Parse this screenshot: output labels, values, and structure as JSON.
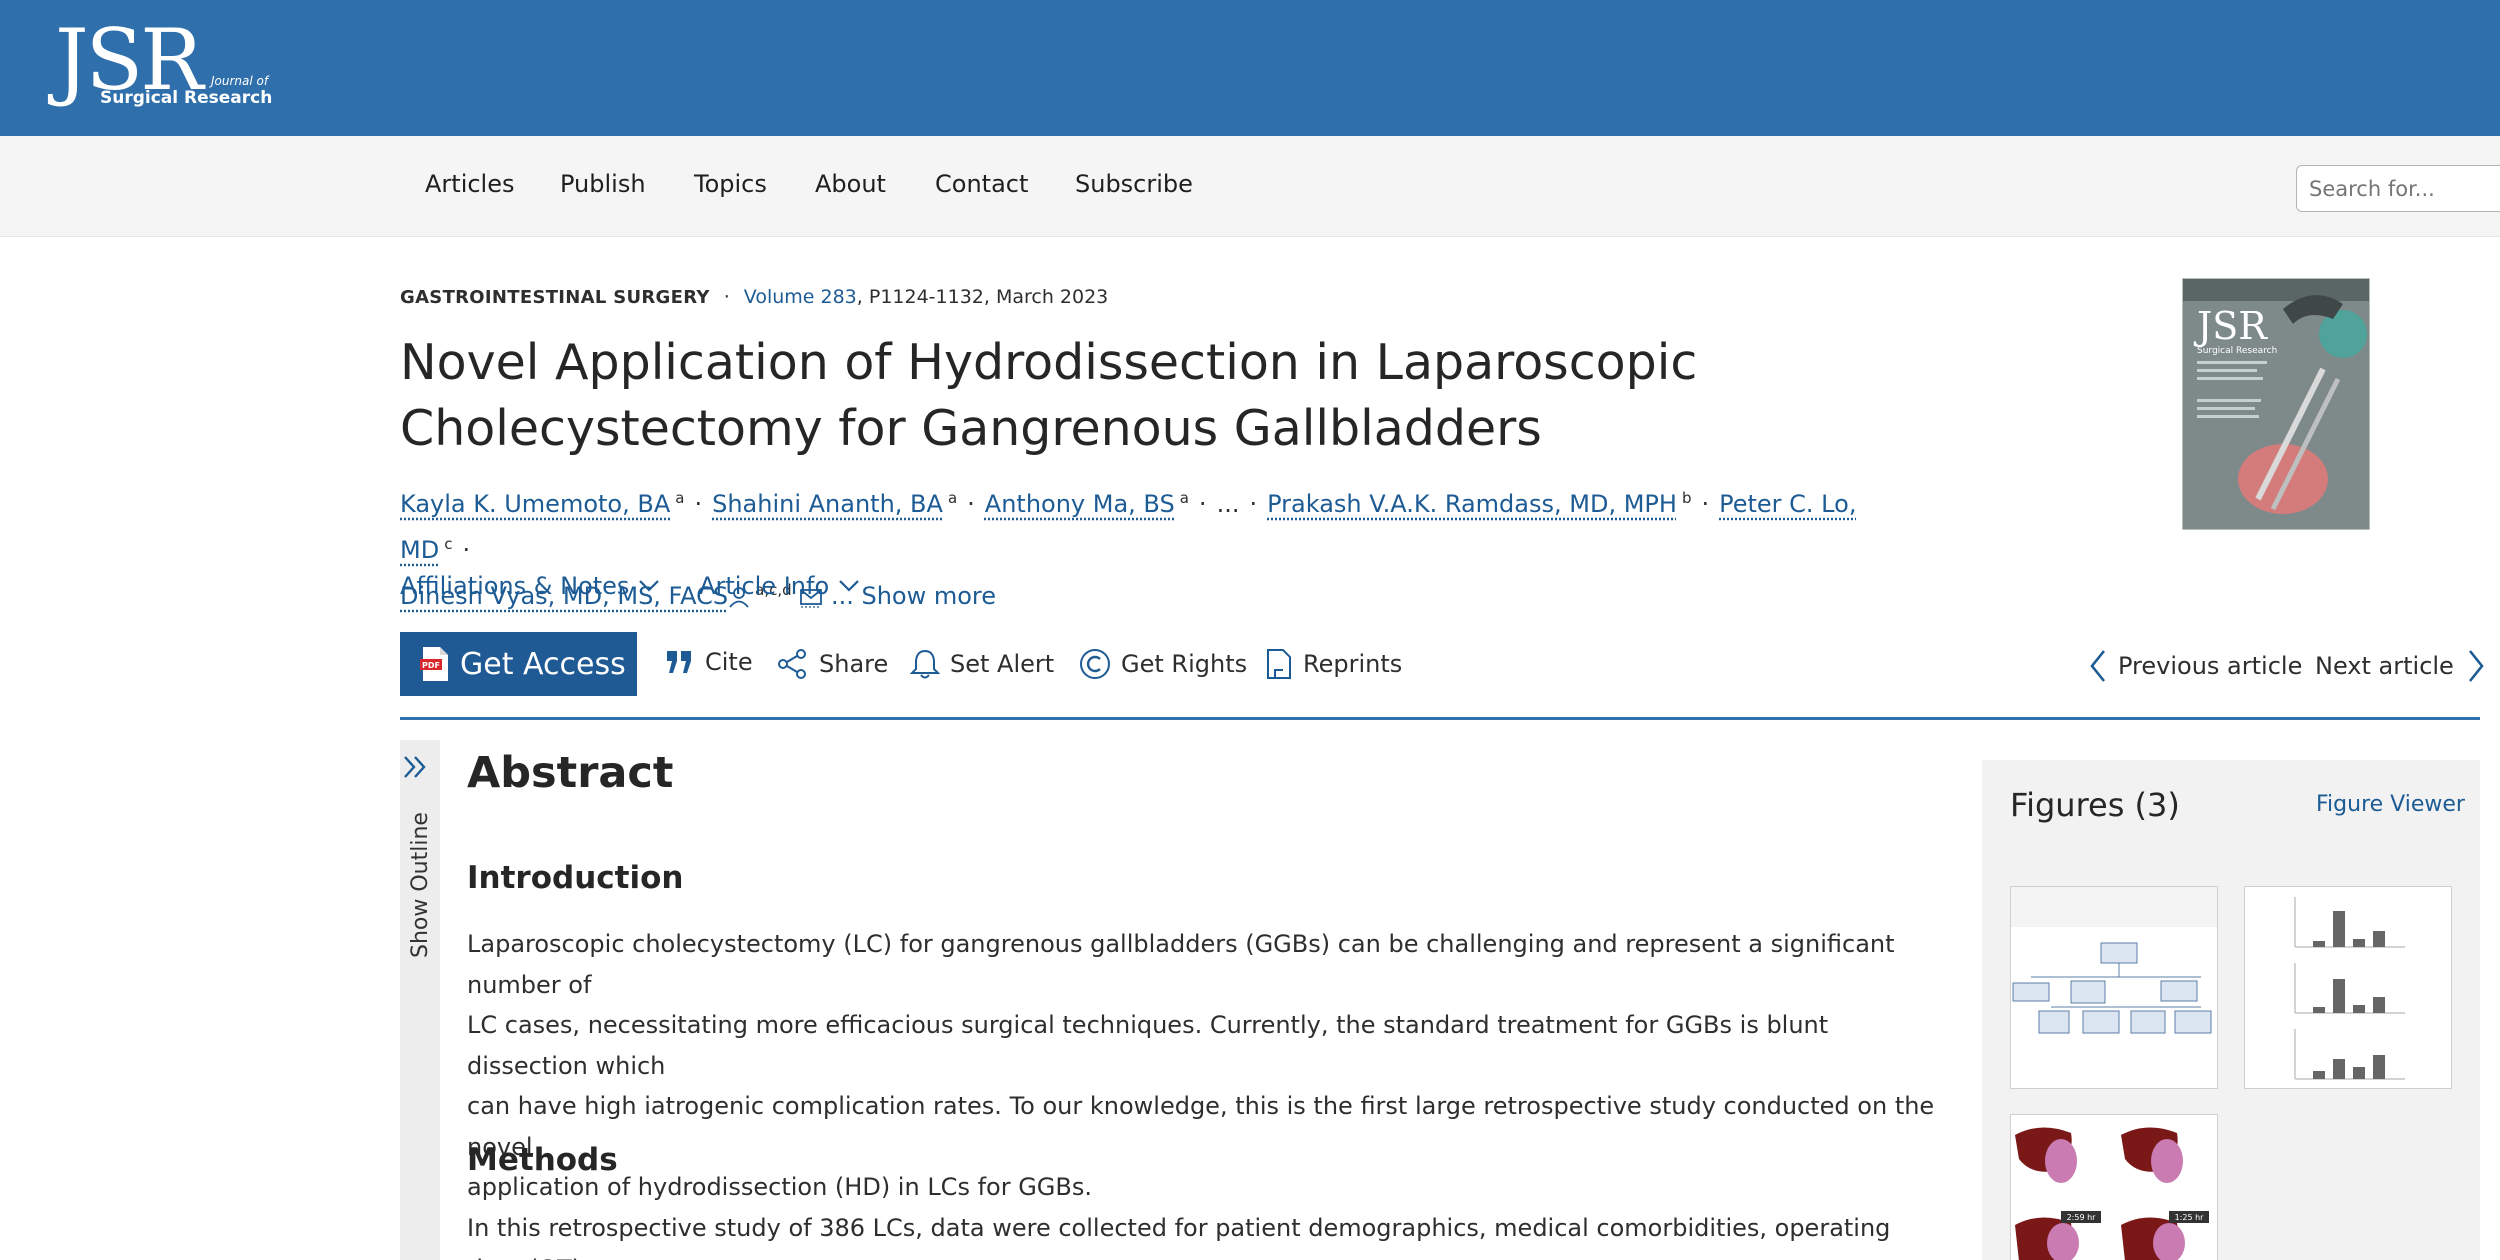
{
  "header": {
    "logo_mark": "JSR",
    "logo_sub1": "Journal of",
    "logo_sub2": "Surgical Research",
    "brand_color": "#2f6fab"
  },
  "nav": {
    "items": [
      "Articles",
      "Publish",
      "Topics",
      "About",
      "Contact",
      "Subscribe"
    ],
    "search_placeholder": "Search for..."
  },
  "article": {
    "section": "GASTROINTESTINAL SURGERY",
    "volume": "Volume 283",
    "pages_date": ", P1124-1132, March 2023",
    "title_line1": "Novel Application of Hydrodissection in Laparoscopic",
    "title_line2": "Cholecystectomy for Gangrenous Gallbladders",
    "authors": [
      {
        "name": "Kayla K. Umemoto, BA",
        "sup": "a"
      },
      {
        "name": "Shahini Ananth, BA",
        "sup": "a"
      },
      {
        "name": "Anthony Ma, BS",
        "sup": "a"
      },
      {
        "name": "Prakash V.A.K. Ramdass, MD, MPH",
        "sup": "b"
      },
      {
        "name": "Peter C. Lo, MD",
        "sup": "c"
      },
      {
        "name": "Dinesh Vyas, MD, MS, FACS",
        "sup": "a,c,d"
      }
    ],
    "ellipsis": "...",
    "show_more": "... Show more",
    "affiliations": "Affiliations & Notes",
    "article_info": "Article Info"
  },
  "toolbar": {
    "get_access": "Get Access",
    "cite": "Cite",
    "share": "Share",
    "set_alert": "Set Alert",
    "get_rights": "Get Rights",
    "reprints": "Reprints",
    "previous": "Previous article",
    "next": "Next article"
  },
  "outline": {
    "label": "Show Outline"
  },
  "abstract": {
    "heading": "Abstract",
    "intro_heading": "Introduction",
    "intro_lines": [
      "Laparoscopic cholecystectomy (LC) for gangrenous gallbladders (GGBs) can be challenging and represent a significant number of",
      "LC cases, necessitating more efficacious surgical techniques. Currently, the standard treatment for GGBs is blunt dissection which",
      "can have high iatrogenic complication rates. To our knowledge, this is the first large retrospective study conducted on the novel",
      "application of hydrodissection (HD) in LCs for GGBs."
    ],
    "methods_heading": "Methods",
    "methods_line": "In this retrospective study of 386 LCs, data were collected for patient demographics, medical comorbidities, operating time (OT),"
  },
  "figures": {
    "title": "Figures (3)",
    "viewer": "Figure Viewer",
    "thumb3_labels": [
      "2:59 hr",
      "1:25 hr"
    ]
  }
}
